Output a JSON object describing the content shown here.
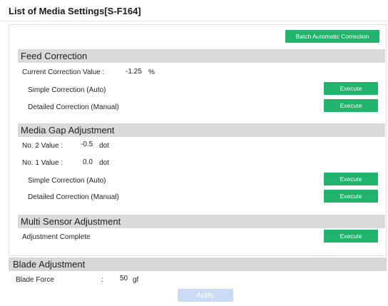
{
  "window": {
    "title": "List of Media Settings[S-F164]"
  },
  "toolbar": {
    "batch_label": "Batch Automatic Correction"
  },
  "feed_correction": {
    "title": "Feed Correction",
    "current_label": "Current Correction Value :",
    "current_value": "-1.25",
    "current_unit": "%",
    "simple_label": "Simple Correction (Auto)",
    "detailed_label": "Detailed Correction (Manual)",
    "execute_label": "Execute"
  },
  "media_gap": {
    "title": "Media Gap Adjustment",
    "no2_label": "No. 2 Value :",
    "no2_value": "-0.5",
    "no2_unit": "dot",
    "no1_label": "No. 1 Value :",
    "no1_value": "0.0",
    "no1_unit": "dot",
    "simple_label": "Simple Correction (Auto)",
    "detailed_label": "Detailed Correction (Manual)",
    "execute_label": "Execute"
  },
  "multi_sensor": {
    "title": "Multi Sensor Adjustment",
    "status_label": "Adjustment Complete",
    "execute_label": "Execute"
  },
  "blade": {
    "title": "Blade Adjustment",
    "force_label": "Blade Force",
    "separator": ":",
    "force_value": "50",
    "force_unit": "gf"
  },
  "footer": {
    "apply_label": "Apply"
  },
  "colors": {
    "accent_green": "#21b26b",
    "section_gray": "#dadada",
    "apply_disabled": "#c9dbf5"
  }
}
